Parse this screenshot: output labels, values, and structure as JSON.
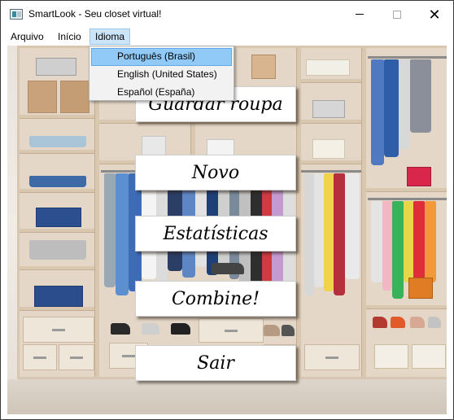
{
  "window": {
    "title": "SmartLook - Seu closet virtual!"
  },
  "menubar": {
    "items": [
      {
        "label": "Arquivo"
      },
      {
        "label": "Início"
      },
      {
        "label": "Idioma"
      }
    ]
  },
  "language_menu": {
    "items": [
      {
        "label": "Português (Brasil)",
        "selected": true
      },
      {
        "label": "English (United States)",
        "selected": false
      },
      {
        "label": "Español (España)",
        "selected": false
      }
    ]
  },
  "main": {
    "buttons": [
      {
        "label": "Guardar roupa"
      },
      {
        "label": "Novo"
      },
      {
        "label": "Estatísticas"
      },
      {
        "label": "Combine!"
      },
      {
        "label": "Sair"
      }
    ]
  },
  "colors": {
    "menu_highlight": "#cce4f7",
    "dropdown_selected": "#91c9f7",
    "background_wood": "#e4d7c7"
  }
}
